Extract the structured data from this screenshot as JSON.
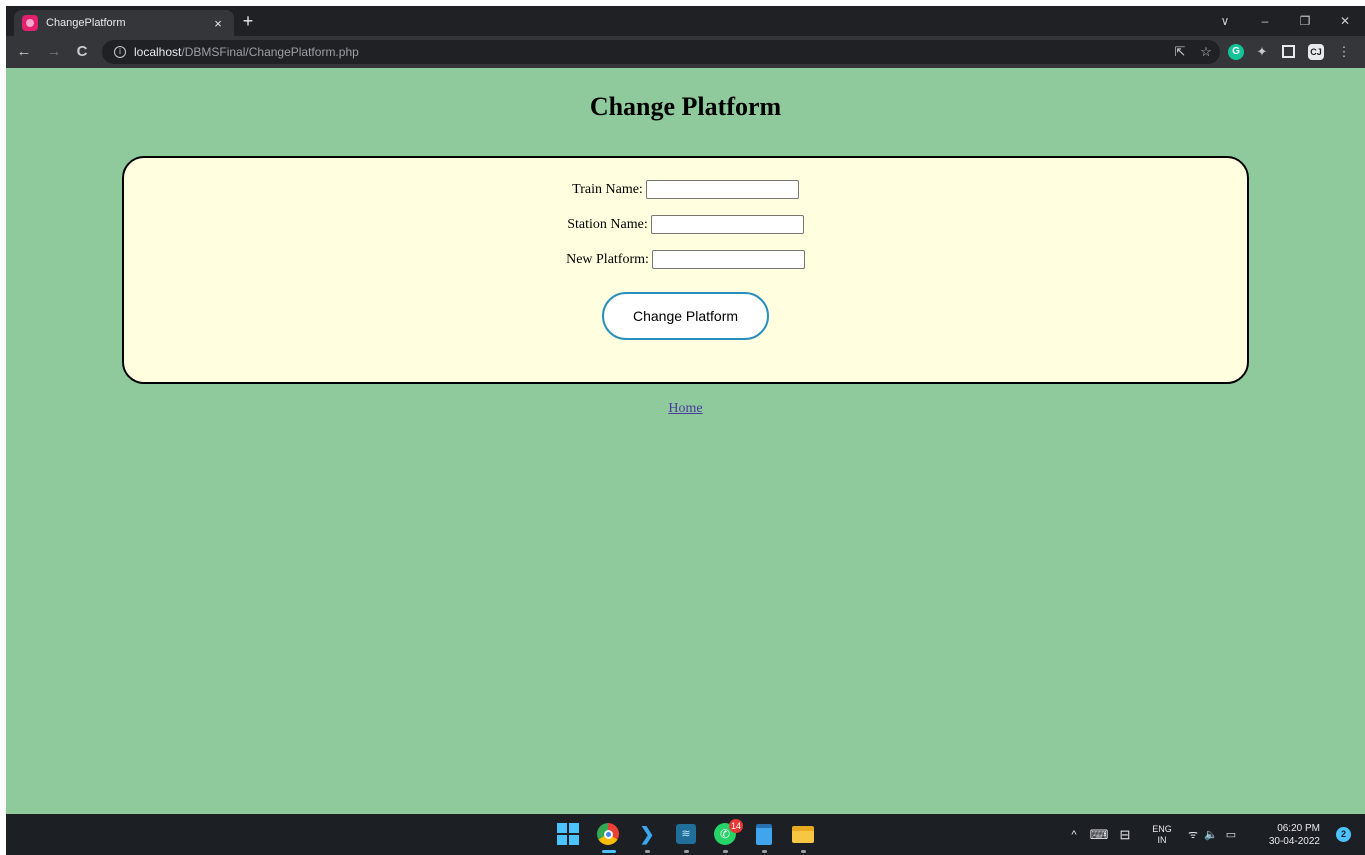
{
  "browser": {
    "tab": {
      "title": "ChangePlatform",
      "close_glyph": "×"
    },
    "new_tab_glyph": "+",
    "window_controls": {
      "tab_search": "∨",
      "minimize": "–",
      "restore": "❐",
      "close": "✕"
    },
    "nav": {
      "back": "←",
      "forward": "→",
      "reload": "C"
    },
    "address": {
      "info_glyph": "i",
      "host": "localhost",
      "path": "/DBMSFinal/ChangePlatform.php"
    },
    "toolbar_icons": {
      "share": "⇱",
      "bookmark": "☆",
      "grammarly": "G",
      "extensions": "✦",
      "sidepanel": "",
      "cj": "CJ",
      "menu": "⋮"
    }
  },
  "page": {
    "title": "Change Platform",
    "background": "#8fca9d",
    "card_background": "#ffffe0",
    "form": {
      "fields": [
        {
          "label": "Train Name:",
          "value": ""
        },
        {
          "label": "Station Name:",
          "value": ""
        },
        {
          "label": "New Platform:",
          "value": ""
        }
      ],
      "submit_label": "Change Platform",
      "submit_border_color": "#2a8fbd"
    },
    "home_link": "Home"
  },
  "taskbar": {
    "apps": [
      {
        "name": "windows-start",
        "icon": "windows-logo-icon"
      },
      {
        "name": "chrome",
        "icon": "chrome-icon",
        "running": true,
        "active": true
      },
      {
        "name": "vscode",
        "icon": "vscode-icon",
        "glyph": "❯",
        "running": true
      },
      {
        "name": "mysql-workbench",
        "icon": "mysql-icon",
        "glyph": "≋",
        "running": true
      },
      {
        "name": "whatsapp",
        "icon": "whatsapp-icon",
        "glyph": "✆",
        "badge": "14",
        "running": true
      },
      {
        "name": "notepad",
        "icon": "notepad-icon",
        "running": true
      },
      {
        "name": "file-explorer",
        "icon": "folder-icon",
        "running": true
      }
    ],
    "tray": {
      "chevron": "^",
      "keyboard": "⌨",
      "display": "⊟",
      "language": {
        "line1": "ENG",
        "line2": "IN"
      },
      "wifi": "ᯤ",
      "volume": "🔈",
      "battery": "▭",
      "time": "06:20 PM",
      "date": "30-04-2022",
      "notification_count": "2"
    }
  }
}
